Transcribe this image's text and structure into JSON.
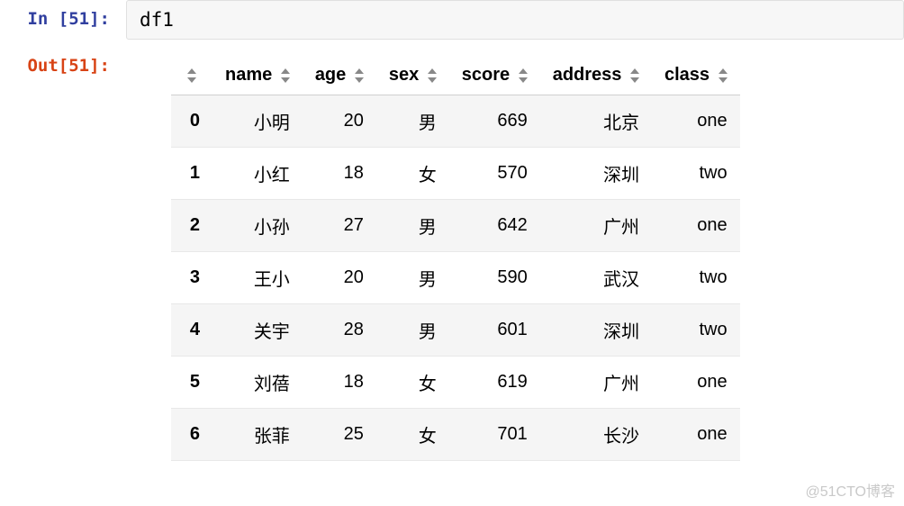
{
  "input_cell": {
    "prompt_label": "In [",
    "prompt_number": "51",
    "prompt_close": "]:",
    "code": "df1"
  },
  "output_cell": {
    "prompt_label": "Out[",
    "prompt_number": "51",
    "prompt_close": "]:"
  },
  "chart_data": {
    "type": "table",
    "columns": [
      "name",
      "age",
      "sex",
      "score",
      "address",
      "class"
    ],
    "index": [
      "0",
      "1",
      "2",
      "3",
      "4",
      "5",
      "6"
    ],
    "rows": [
      {
        "name": "小明",
        "age": "20",
        "sex": "男",
        "score": "669",
        "address": "北京",
        "class": "one"
      },
      {
        "name": "小红",
        "age": "18",
        "sex": "女",
        "score": "570",
        "address": "深圳",
        "class": "two"
      },
      {
        "name": "小孙",
        "age": "27",
        "sex": "男",
        "score": "642",
        "address": "广州",
        "class": "one"
      },
      {
        "name": "王小",
        "age": "20",
        "sex": "男",
        "score": "590",
        "address": "武汉",
        "class": "two"
      },
      {
        "name": "关宇",
        "age": "28",
        "sex": "男",
        "score": "601",
        "address": "深圳",
        "class": "two"
      },
      {
        "name": "刘蓓",
        "age": "18",
        "sex": "女",
        "score": "619",
        "address": "广州",
        "class": "one"
      },
      {
        "name": "张菲",
        "age": "25",
        "sex": "女",
        "score": "701",
        "address": "长沙",
        "class": "one"
      }
    ]
  },
  "watermark": "@51CTO博客"
}
